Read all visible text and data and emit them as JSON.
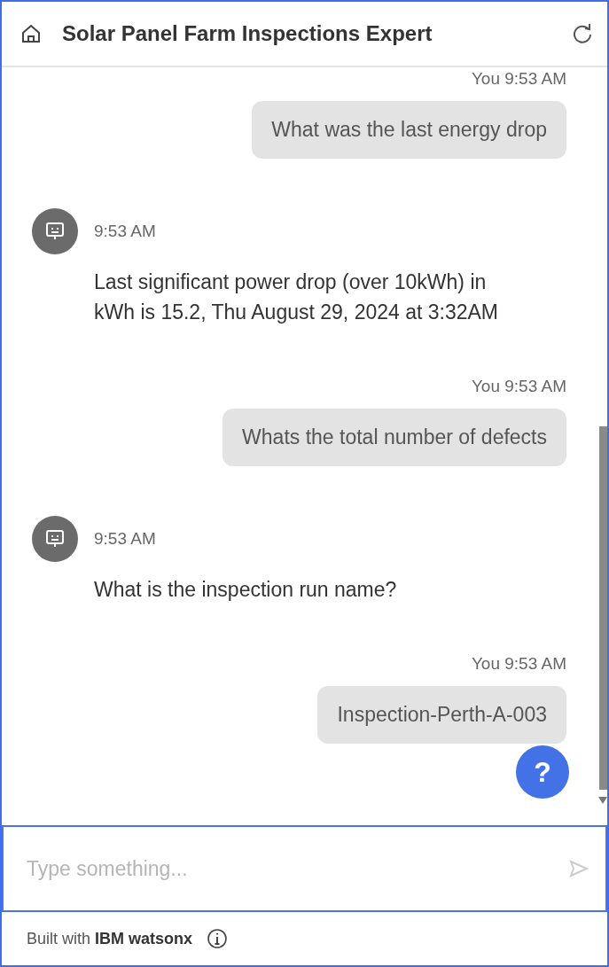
{
  "header": {
    "title": "Solar Panel Farm Inspections Expert"
  },
  "messages": [
    {
      "kind": "user",
      "meta": "You 9:53 AM",
      "text": "What was the last energy drop"
    },
    {
      "kind": "bot",
      "meta": "9:53 AM",
      "text": "Last significant power drop (over 10kWh) in kWh is 15.2, Thu August 29, 2024 at 3:32AM"
    },
    {
      "kind": "user",
      "meta": "You 9:53 AM",
      "text": "Whats the total number of defects"
    },
    {
      "kind": "bot",
      "meta": "9:53 AM",
      "text": "What is the inspection run name?"
    },
    {
      "kind": "user",
      "meta": "You 9:53 AM",
      "text": "Inspection-Perth-A-003"
    }
  ],
  "help_button": {
    "label": "?"
  },
  "input": {
    "placeholder": "Type something..."
  },
  "footer": {
    "text": "Built with **IBM watsonx**"
  }
}
